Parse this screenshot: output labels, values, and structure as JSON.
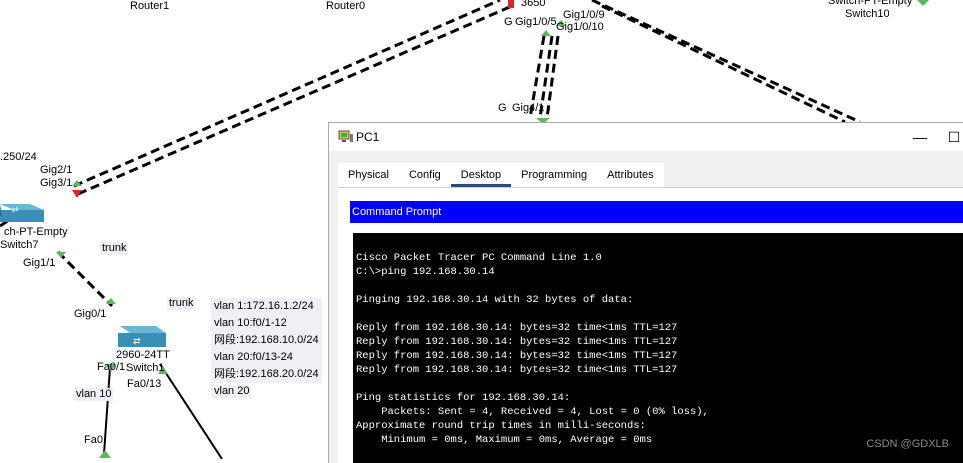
{
  "topology": {
    "devices": [
      {
        "key": "router1",
        "label": "Router1"
      },
      {
        "key": "router0",
        "label": "Router0"
      },
      {
        "key": "switch7",
        "label_line1": "ch-PT-Empty",
        "label_line2": "Switch7"
      },
      {
        "key": "switch10",
        "label_line1": "Switch-PT-Empty",
        "label_line2": "Switch10"
      },
      {
        "key": "core",
        "label": "3650"
      },
      {
        "key": "access",
        "label_line1": "2960-24TT",
        "label_line2": "Switch1"
      }
    ],
    "ports": {
      "gig1_0_5": "Gig1/0/5",
      "gig1_0_9": "Gig1/0/9",
      "gig1_0_10": "Gig1/0/10",
      "gig4_1": "Gig4/1",
      "gig2_1": "Gig2/1",
      "gig3_1": "Gig3/1",
      "gig1_1": "Gig1/1",
      "gig0_1": "Gig0/1",
      "fa0_1": "Fa0/1",
      "fa0_13": "Fa0/13",
      "fa0": "Fa0"
    },
    "partial_labels": {
      "ip_250": ".250/24",
      "g_left_core": "G",
      "g_left_gig4": "G"
    },
    "links": {
      "trunk1": "trunk",
      "trunk2": "trunk",
      "vlan10": "vlan 10",
      "vlan20": "vlan 20"
    },
    "vlan_note": [
      "vlan 1:172.16.1.2/24",
      "vlan 10:f0/1-12",
      "网段:192.168.10.0/24",
      "vlan 20:f0/13-24",
      "网段:192.168.20.0/24"
    ],
    "colors": {
      "link_up": "#5cb85c",
      "link_down": "#d9232e",
      "switch": "#3a8fb7"
    }
  },
  "window": {
    "title": "PC1",
    "minimize_glyph": "—",
    "maximize_glyph": "☐",
    "tabs": [
      "Physical",
      "Config",
      "Desktop",
      "Programming",
      "Attributes"
    ],
    "active_tab": "Desktop",
    "command_prompt_title": "Command Prompt",
    "console_lines": [
      "Cisco Packet Tracer PC Command Line 1.0",
      "C:\\>ping 192.168.30.14",
      "",
      "Pinging 192.168.30.14 with 32 bytes of data:",
      "",
      "Reply from 192.168.30.14: bytes=32 time<1ms TTL=127",
      "Reply from 192.168.30.14: bytes=32 time<1ms TTL=127",
      "Reply from 192.168.30.14: bytes=32 time<1ms TTL=127",
      "Reply from 192.168.30.14: bytes=32 time<1ms TTL=127",
      "",
      "Ping statistics for 192.168.30.14:",
      "    Packets: Sent = 4, Received = 4, Lost = 0 (0% loss),",
      "Approximate round trip times in milli-seconds:",
      "    Minimum = 0ms, Maximum = 0ms, Average = 0ms"
    ]
  },
  "watermark": "CSDN @GDXLB"
}
